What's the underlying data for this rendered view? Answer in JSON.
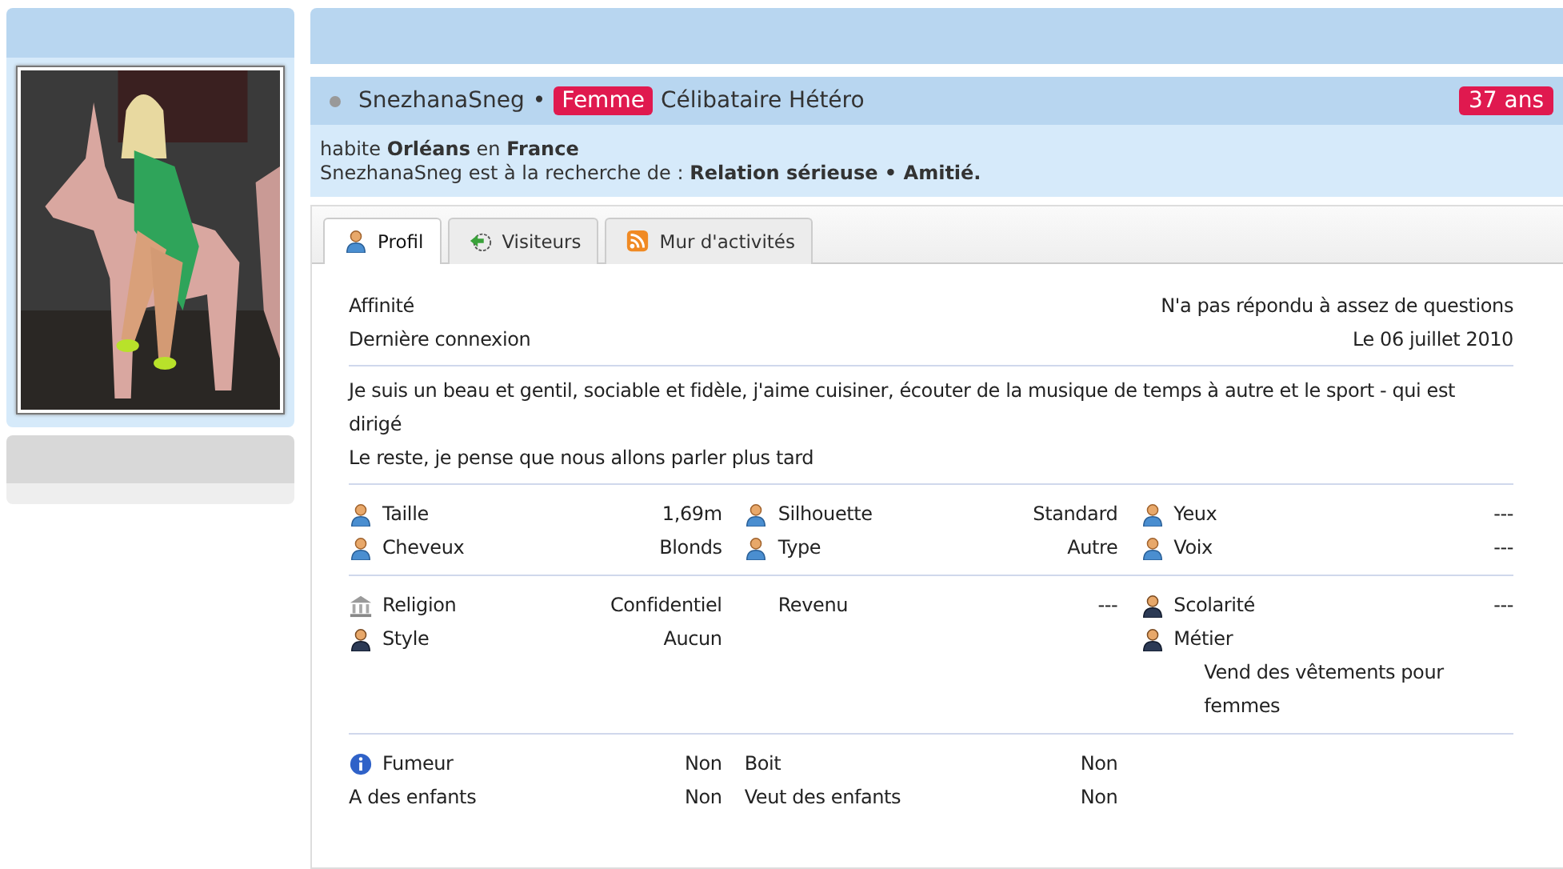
{
  "profile": {
    "username": "SnezhanaSneg",
    "separator": "•",
    "gender": "Femme",
    "status": "Célibataire Hétéro",
    "age": "37 ans",
    "online": false
  },
  "location": "habite **Orléans** en **France**",
  "seeking": "SnezhanaSneg est à la recherche de : **Relation sérieuse • Amitié.**",
  "tabs": [
    {
      "label": "Profil",
      "kind": "person",
      "selected": true
    },
    {
      "label": "Visiteurs",
      "kind": "visitors",
      "selected": false
    },
    {
      "label": "Mur d'activités",
      "kind": "feed",
      "selected": false
    }
  ],
  "summary": [
    {
      "label": "Affinité",
      "value": "N'a pas répondu à assez de questions"
    },
    {
      "label": "Dernière connexion",
      "value": "Le 06 juillet 2010"
    }
  ],
  "description": [
    "Je suis un beau et gentil, sociable et fidèle, j'aime cuisiner, écouter de la musique de temps à autre et le sport - qui est dirigé",
    "Le reste, je pense que nous allons parler plus tard"
  ],
  "groups": [
    {
      "rows": [
        [
          {
            "kind": "person",
            "label": "Taille",
            "value": "1,69m"
          },
          {
            "kind": "person",
            "label": "Silhouette",
            "value": "Standard"
          },
          {
            "kind": "person",
            "label": "Yeux",
            "value": "---"
          }
        ],
        [
          {
            "kind": "person",
            "label": "Cheveux",
            "value": "Blonds"
          },
          {
            "kind": "person",
            "label": "Type",
            "value": "Autre"
          },
          {
            "kind": "person",
            "label": "Voix",
            "value": "---"
          }
        ]
      ]
    },
    {
      "rows": [
        [
          {
            "kind": "bank",
            "label": "Religion",
            "value": "Confidentiel"
          },
          {
            "kind": "blank",
            "label": "Revenu",
            "value": "---"
          },
          {
            "kind": "person-dark",
            "label": "Scolarité",
            "value": "---"
          }
        ],
        [
          {
            "kind": "person-dark",
            "label": "Style",
            "value": "Aucun"
          },
          null,
          {
            "kind": "person-dark",
            "label": "Métier"
          }
        ]
      ],
      "note": "Vend des vêtements pour femmes"
    },
    {
      "rows": [
        [
          {
            "kind": "info",
            "label": "Fumeur",
            "value": "Non"
          },
          {
            "kind": "none",
            "label": "Boit",
            "value": "Non"
          },
          null
        ],
        [
          {
            "kind": "none",
            "label": "A des enfants",
            "value": "Non"
          },
          {
            "kind": "none",
            "label": "Veut des enfants",
            "value": "Non"
          },
          null
        ]
      ]
    }
  ]
}
